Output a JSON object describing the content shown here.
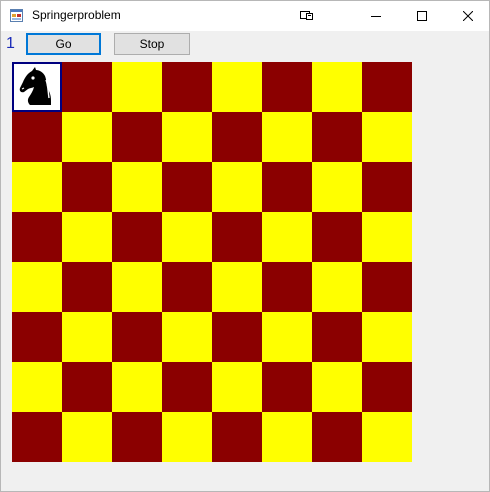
{
  "window": {
    "title": "Springerproblem",
    "app_icon": "windows-form-icon",
    "controls": [
      "restore-size-icon",
      "minimize-icon",
      "maximize-icon",
      "close-icon"
    ]
  },
  "toolbar": {
    "counter": "1",
    "go_label": "Go",
    "stop_label": "Stop"
  },
  "board": {
    "rows": 8,
    "cols": 8,
    "dark_color": "#8b0000",
    "light_color": "#ffff00",
    "top_left_is_light": true,
    "knight": {
      "icon": "knight-icon",
      "row": 0,
      "col": 0,
      "highlight_color": "#000080"
    }
  },
  "colors": {
    "counter": "#1c2cb8",
    "focus_border": "#0078d7"
  }
}
